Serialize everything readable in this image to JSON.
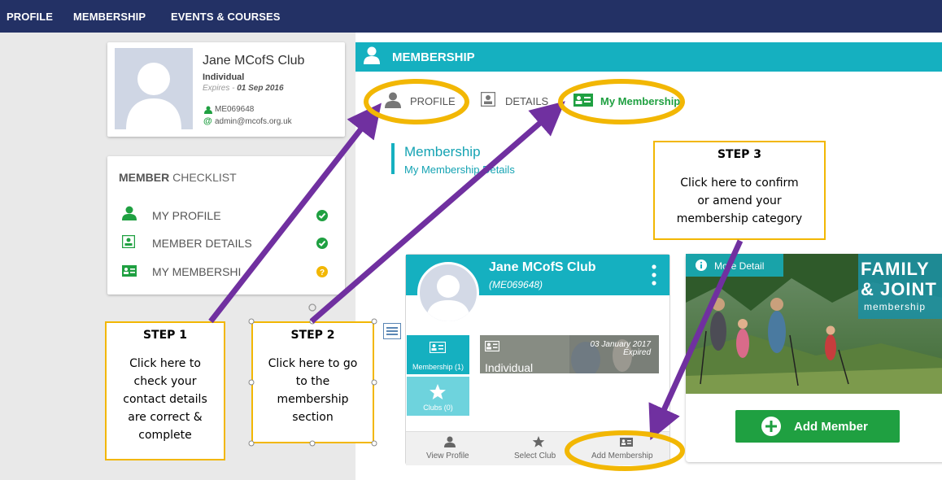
{
  "nav": {
    "items": [
      "PROFILE",
      "MEMBERSHIP",
      "EVENTS & COURSES"
    ]
  },
  "profile_card": {
    "name": "Jane MCofS Club",
    "type": "Individual",
    "expires_label": "Expires - ",
    "expires_date": "01 Sep 2016",
    "member_id": "ME069648",
    "email": "admin@mcofs.org.uk"
  },
  "checklist": {
    "title_bold": "MEMBER",
    "title_rest": " CHECKLIST",
    "items": [
      {
        "label": "MY PROFILE",
        "status": "complete"
      },
      {
        "label": "MEMBER DETAILS",
        "status": "complete"
      },
      {
        "label": "MY MEMBERSHI",
        "status": "pending"
      }
    ]
  },
  "membership": {
    "header": "MEMBERSHIP",
    "tabs": [
      "PROFILE",
      "DETAILS",
      "My Membership"
    ],
    "section_title": "Membership",
    "section_sub": "My Membership Details"
  },
  "member_card": {
    "name": "Jane MCofS Club",
    "id": "(ME069648)",
    "tab_membership": "Membership (1)",
    "tab_clubs": "Clubs (0)",
    "item_date": "03 January 2017",
    "item_status": "Expired",
    "item_type": "Individual",
    "footer": [
      "View Profile",
      "Select Club",
      "Add Membership"
    ]
  },
  "family_card": {
    "more_detail": "More Detail",
    "line1": "FAMILY",
    "line2": "& JOINT",
    "line3": "membership",
    "button": "Add Member"
  },
  "steps": [
    {
      "title": "STEP 1",
      "text": [
        "Click here to",
        "check your",
        "contact details",
        "are correct &",
        "complete"
      ]
    },
    {
      "title": "STEP 2",
      "text": [
        "Click here to go",
        "to the",
        "membership",
        "section"
      ]
    },
    {
      "title": "STEP 3",
      "text": [
        "Click here to confirm",
        "or amend your",
        "membership category"
      ]
    }
  ],
  "colors": {
    "nav_bg": "#233165",
    "accent_teal": "#15b0c0",
    "green": "#1fa041",
    "highlight_yellow": "#f2b704",
    "arrow_purple": "#7030a0"
  }
}
